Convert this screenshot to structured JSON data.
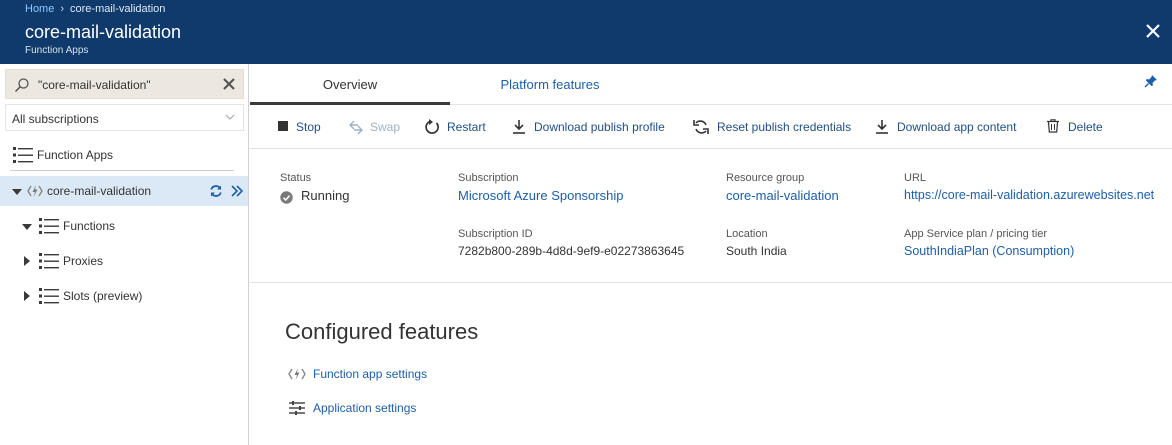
{
  "header": {
    "breadcrumb": {
      "home": "Home",
      "sep": "›",
      "current": "core-mail-validation"
    },
    "title": "core-mail-validation",
    "subtitle": "Function Apps"
  },
  "sidebar": {
    "search_value": "\"core-mail-validation\"",
    "subscription_select": "All subscriptions",
    "function_apps_label": "Function Apps",
    "app_name": "core-mail-validation",
    "children": [
      {
        "label": "Functions",
        "expanded": true
      },
      {
        "label": "Proxies",
        "expanded": false
      },
      {
        "label": "Slots (preview)",
        "expanded": false
      }
    ]
  },
  "tabs": {
    "overview": "Overview",
    "platform": "Platform features"
  },
  "toolbar": {
    "stop": "Stop",
    "swap": "Swap",
    "restart": "Restart",
    "download_profile": "Download publish profile",
    "reset_credentials": "Reset publish credentials",
    "download_content": "Download app content",
    "delete": "Delete"
  },
  "essentials": {
    "status_label": "Status",
    "status_value": "Running",
    "subscription_label": "Subscription",
    "subscription_value": "Microsoft Azure Sponsorship",
    "subscription_id_label": "Subscription ID",
    "subscription_id_value": "7282b800-289b-4d8d-9ef9-e02273863645",
    "resource_group_label": "Resource group",
    "resource_group_value": "core-mail-validation",
    "location_label": "Location",
    "location_value": "South India",
    "url_label": "URL",
    "url_value": "https://core-mail-validation.azurewebsites.net",
    "plan_label": "App Service plan / pricing tier",
    "plan_value": "SouthIndiaPlan (Consumption)"
  },
  "configured": {
    "title": "Configured features",
    "function_app_settings": "Function app settings",
    "application_settings": "Application settings"
  },
  "colors": {
    "header_bg": "#0f3a6b",
    "link": "#1e5fa8",
    "selected_row": "#dbe9f6",
    "running_dot": "#7a7a7a"
  }
}
